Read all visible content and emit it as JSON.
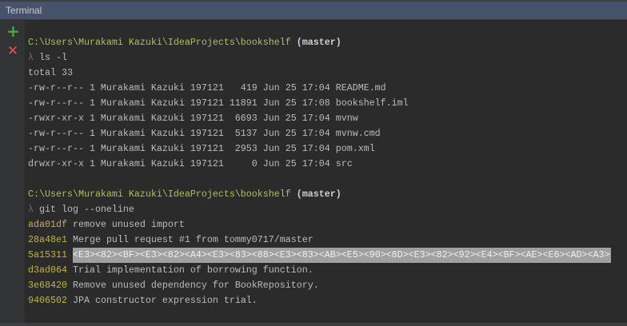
{
  "window": {
    "title": "Terminal"
  },
  "toolbar": {
    "add_icon": "plus-icon",
    "close_icon": "close-icon"
  },
  "session1": {
    "path": "C:\\Users\\Murakami Kazuki\\IdeaProjects\\bookshelf",
    "branch": " (master)",
    "prompt": "λ",
    "command": " ls -l",
    "output": [
      "total 33",
      "-rw-r--r-- 1 Murakami Kazuki 197121   419 Jun 25 17:04 README.md",
      "-rw-r--r-- 1 Murakami Kazuki 197121 11891 Jun 25 17:08 bookshelf.iml",
      "-rwxr-xr-x 1 Murakami Kazuki 197121  6693 Jun 25 17:04 mvnw",
      "-rw-r--r-- 1 Murakami Kazuki 197121  5137 Jun 25 17:04 mvnw.cmd",
      "-rw-r--r-- 1 Murakami Kazuki 197121  2953 Jun 25 17:04 pom.xml",
      "drwxr-xr-x 1 Murakami Kazuki 197121     0 Jun 25 17:04 src"
    ]
  },
  "session2": {
    "path": "C:\\Users\\Murakami Kazuki\\IdeaProjects\\bookshelf",
    "branch": " (master)",
    "prompt": "λ",
    "command": " git log --oneline",
    "commits": [
      {
        "hash": "ada01df",
        "msg": "remove unused import"
      },
      {
        "hash": "28a48e1",
        "msg": "Merge pull request #1 from tommy0717/master"
      },
      {
        "hash": "5a15311",
        "msg": "<E3><82><BF><E3><82><A4><E3><83><88><E3><83><AB><E5><90><8D><E3><82><92><E4><BF><AE><E6><AD><A3>"
      },
      {
        "hash": "d3ad064",
        "msg": "Trial implementation of borrowing function."
      },
      {
        "hash": "3e68420",
        "msg": "Remove unused dependency for BookRepository."
      },
      {
        "hash": "9406502",
        "msg": "JPA constructor expression trial."
      }
    ]
  }
}
